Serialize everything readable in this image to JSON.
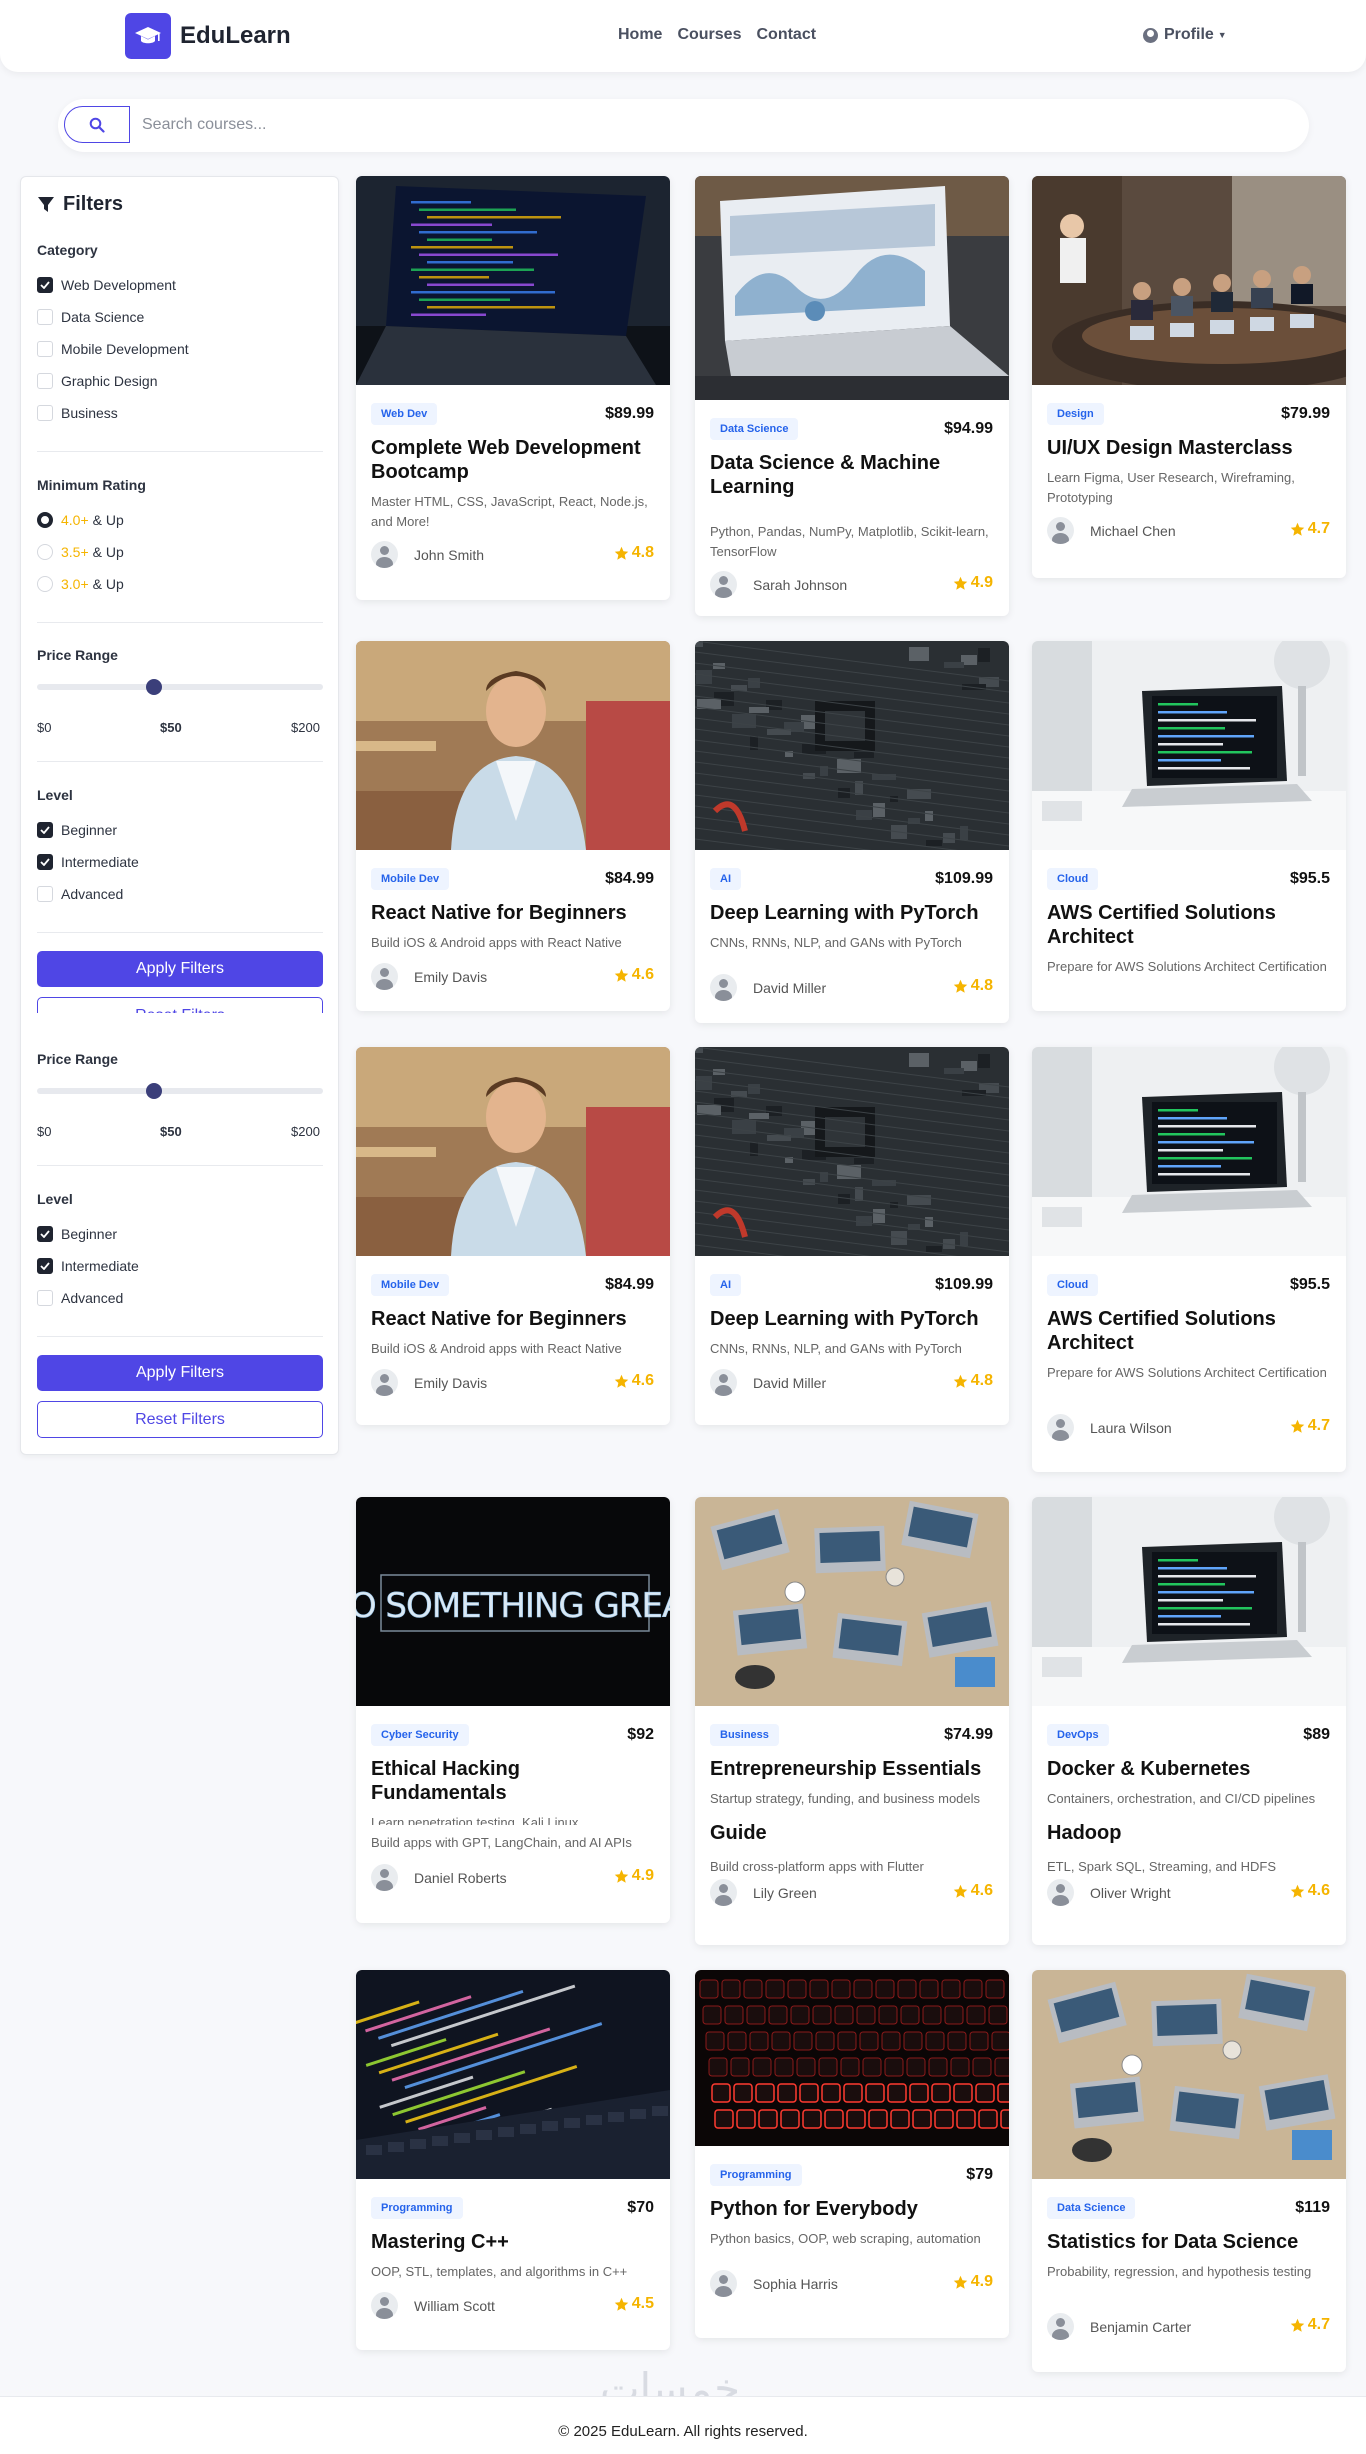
{
  "navbar": {
    "brand": "EduLearn",
    "links": [
      "Home",
      "Courses",
      "Contact"
    ],
    "profile": "Profile"
  },
  "search": {
    "placeholder": "Search courses..."
  },
  "filters": {
    "title": "Filters",
    "category_title": "Category",
    "categories": [
      {
        "label": "Web Development",
        "checked": true
      },
      {
        "label": "Data Science",
        "checked": false
      },
      {
        "label": "Mobile Development",
        "checked": false
      },
      {
        "label": "Graphic Design",
        "checked": false
      },
      {
        "label": "Business",
        "checked": false
      }
    ],
    "rating_title": "Minimum Rating",
    "ratings": [
      {
        "value": "4.0+",
        "suffix": "& Up",
        "selected": true
      },
      {
        "value": "3.5+",
        "suffix": "& Up",
        "selected": false
      },
      {
        "value": "3.0+",
        "suffix": "& Up",
        "selected": false
      }
    ],
    "price_title": "Price Range",
    "price_min": "$0",
    "price_current": "$50",
    "price_max": "$200",
    "price_value": 50,
    "price_range_max": 200,
    "level_title": "Level",
    "levels": [
      {
        "label": "Beginner",
        "checked": true
      },
      {
        "label": "Intermediate",
        "checked": true
      },
      {
        "label": "Advanced",
        "checked": false
      }
    ],
    "apply_label": "Apply Filters",
    "reset_label": "Reset Filters"
  },
  "courses": [
    {
      "badge": "Web Dev",
      "price": "$89.99",
      "title": "Complete Web Development Bootcamp",
      "desc": "Master HTML, CSS, JavaScript, React, Node.js, and More!",
      "author": "John Smith",
      "rating": "4.8"
    },
    {
      "badge": "Data Science",
      "price": "$94.99",
      "title": "Data Science & Machine Learning",
      "desc": "Python, Pandas, NumPy, Matplotlib, Scikit-learn, TensorFlow",
      "author": "Sarah Johnson",
      "rating": "4.9"
    },
    {
      "badge": "Design",
      "price": "$79.99",
      "title": "UI/UX Design Masterclass",
      "desc": "Learn Figma, User Research, Wireframing, Prototyping",
      "author": "Michael Chen",
      "rating": "4.7"
    },
    {
      "badge": "Mobile Dev",
      "price": "$84.99",
      "title": "React Native for Beginners",
      "desc": "Build iOS & Android apps with React Native",
      "author": "Emily Davis",
      "rating": "4.6"
    },
    {
      "badge": "AI",
      "price": "$109.99",
      "title": "Deep Learning with PyTorch",
      "desc": "CNNs, RNNs, NLP, and GANs with PyTorch",
      "author": "David Miller",
      "rating": "4.8"
    },
    {
      "badge": "Cloud",
      "price": "$95.5",
      "title": "AWS Certified Solutions Architect",
      "desc": "Prepare for AWS Solutions Architect Certification",
      "author": "",
      "rating": ""
    },
    {
      "badge": "Mobile Dev",
      "price": "$84.99",
      "title": "React Native for Beginners",
      "desc": "Build iOS & Android apps with React Native",
      "author": "Emily Davis",
      "rating": "4.6"
    },
    {
      "badge": "AI",
      "price": "$109.99",
      "title": "Deep Learning with PyTorch",
      "desc": "CNNs, RNNs, NLP, and GANs with PyTorch",
      "author": "David Miller",
      "rating": "4.8"
    },
    {
      "badge": "Cloud",
      "price": "$95.5",
      "title": "AWS Certified Solutions Architect",
      "desc": "Prepare for AWS Solutions Architect Certification",
      "author": "Laura Wilson",
      "rating": "4.7"
    },
    {
      "badge": "Cyber Security",
      "price": "$92",
      "title": "Ethical Hacking Fundamentals",
      "desc": "Learn penetration testing, Kali Linux",
      "desc2": "Build apps with GPT, LangChain, and AI APIs",
      "author": "Daniel Roberts",
      "rating": "4.9"
    },
    {
      "badge": "Business",
      "price": "$74.99",
      "title": "Entrepreneurship Essentials",
      "desc": "Startup strategy, funding, and business models",
      "title2": "Guide",
      "desc2": "Build cross-platform apps with Flutter",
      "author": "Lily Green",
      "rating": "4.6"
    },
    {
      "badge": "DevOps",
      "price": "$89",
      "title": "Docker & Kubernetes",
      "desc": "Containers, orchestration, and CI/CD pipelines",
      "title2": "Hadoop",
      "desc2": "ETL, Spark SQL, Streaming, and HDFS",
      "author": "Oliver Wright",
      "rating": "4.6"
    },
    {
      "badge": "Programming",
      "price": "$70",
      "title": "Mastering C++",
      "desc": "OOP, STL, templates, and algorithms in C++",
      "author": "William Scott",
      "rating": "4.5"
    },
    {
      "badge": "Programming",
      "price": "$79",
      "title": "Python for Everybody",
      "desc": "Python basics, OOP, web scraping, automation",
      "author": "Sophia Harris",
      "rating": "4.9"
    },
    {
      "badge": "Data Science",
      "price": "$119",
      "title": "Statistics for Data Science",
      "desc": "Probability, regression, and hypothesis testing",
      "author": "Benjamin Carter",
      "rating": "4.7"
    }
  ],
  "footer": {
    "text": "© 2025 EduLearn. All rights reserved."
  },
  "colors": {
    "accent": "#4f46e5",
    "star": "#f5b400",
    "badge_text": "#2563eb"
  }
}
